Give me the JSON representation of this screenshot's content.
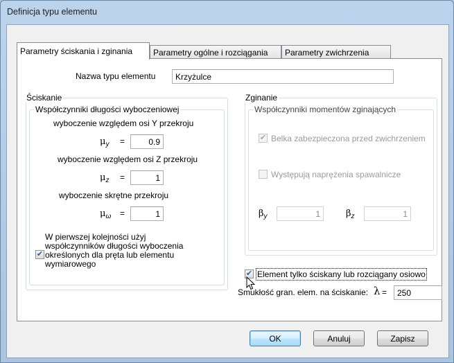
{
  "window": {
    "title": "Definicja typu elementu"
  },
  "tabs": [
    {
      "label": "Parametry ściskania i zginania",
      "active": true
    },
    {
      "label": "Parametry ogólne i rozciągania",
      "active": false
    },
    {
      "label": "Parametry zwichrzenia",
      "active": false
    }
  ],
  "name_field": {
    "label": "Nazwa typu elementu",
    "value": "Krzyżulce"
  },
  "compression": {
    "group_title": "Ściskanie",
    "subgroup_title": "Współczynniki długości wyboczeniowej",
    "y_label": "wyboczenie względem osi Y przekroju",
    "y_symbol": "μ",
    "y_sub": "y",
    "y_value": "0.9",
    "z_label": "wyboczenie względem osi Z przekroju",
    "z_symbol": "μ",
    "z_sub": "z",
    "z_value": "1",
    "w_label": "wyboczenie skrętne przekroju",
    "w_symbol": "μ",
    "w_sub": "ω",
    "w_value": "1",
    "equals": "=",
    "priority_line1": "W pierwszej kolejności użyj",
    "priority_line2": "współczynników długości wyboczenia",
    "priority_line3": "określonych dla pręta lub elementu",
    "priority_line4": "wymiarowego",
    "priority_checked": true
  },
  "bending": {
    "group_title": "Zginanie",
    "subgroup_title": "Współczynniki momentów zginających",
    "beam_label": "Belka zabezpieczona przed zwichrzeniem",
    "beam_checked": true,
    "welding_label": "Występują naprężenia spawalnicze",
    "welding_checked": false,
    "beta_y_symbol": "β",
    "beta_y_sub": "y",
    "beta_y_value": "1",
    "beta_z_symbol": "β",
    "beta_z_sub": "z",
    "beta_z_value": "1"
  },
  "axial": {
    "label": "Element tylko ściskany lub rozciągany osiowo",
    "checked": true
  },
  "slenderness": {
    "label": "Smukłość gran. elem. na ściskanie:",
    "symbol": "λ",
    "equals": "=",
    "value": "250"
  },
  "buttons": {
    "ok": "OK",
    "cancel": "Anuluj",
    "save": "Zapisz"
  }
}
